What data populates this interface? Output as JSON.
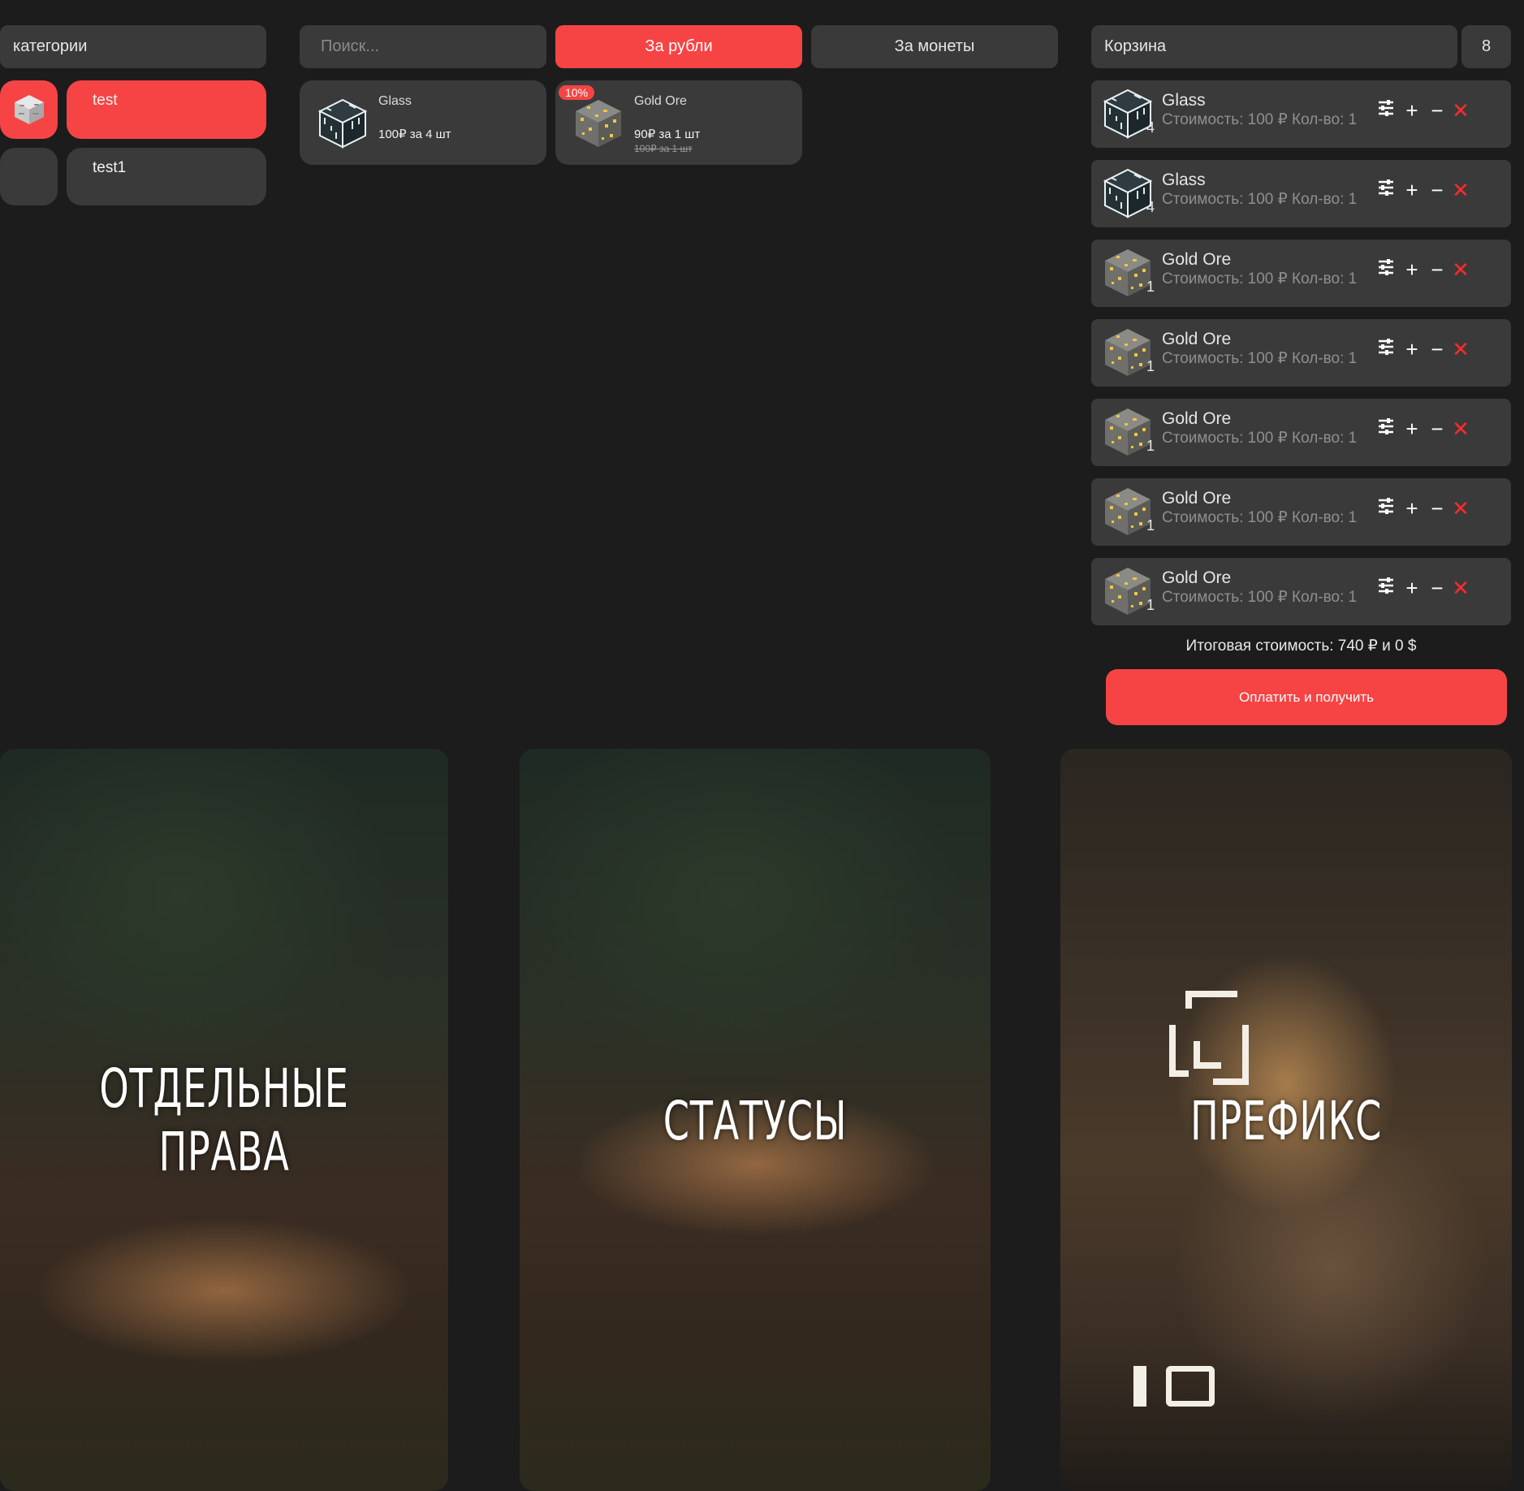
{
  "categories": {
    "header": "категории",
    "items": [
      {
        "label": "test",
        "active": true
      },
      {
        "label": "test1",
        "active": false
      }
    ]
  },
  "search": {
    "placeholder": "Поиск..."
  },
  "currency_tabs": {
    "rubles": "За рубли",
    "coins": "За монеты"
  },
  "products": [
    {
      "name": "Glass",
      "price": "100₽ за 4 шт",
      "icon": "glass-block-icon"
    },
    {
      "name": "Gold Ore",
      "price": "90₽ за 1 шт",
      "old_price": "100₽ за 1 шт",
      "discount": "10%",
      "icon": "gold-ore-icon"
    }
  ],
  "cart": {
    "title": "Корзина",
    "count": "8",
    "items": [
      {
        "name": "Glass",
        "info": "Стоимость: 100 ₽ Кол-во: 1",
        "qty": "4",
        "icon": "glass-block-icon"
      },
      {
        "name": "Glass",
        "info": "Стоимость: 100 ₽ Кол-во: 1",
        "qty": "4",
        "icon": "glass-block-icon"
      },
      {
        "name": "Gold Ore",
        "info": "Стоимость: 100 ₽ Кол-во: 1",
        "qty": "1",
        "icon": "gold-ore-icon"
      },
      {
        "name": "Gold Ore",
        "info": "Стоимость: 100 ₽ Кол-во: 1",
        "qty": "1",
        "icon": "gold-ore-icon"
      },
      {
        "name": "Gold Ore",
        "info": "Стоимость: 100 ₽ Кол-во: 1",
        "qty": "1",
        "icon": "gold-ore-icon"
      },
      {
        "name": "Gold Ore",
        "info": "Стоимость: 100 ₽ Кол-во: 1",
        "qty": "1",
        "icon": "gold-ore-icon"
      },
      {
        "name": "Gold Ore",
        "info": "Стоимость: 100 ₽ Кол-во: 1",
        "qty": "1",
        "icon": "gold-ore-icon"
      }
    ],
    "controls": {
      "plus": "+",
      "minus": "−",
      "delete": "✕"
    },
    "total": "Итоговая стоимость: 740 ₽ и 0 $",
    "pay_label": "Оплатить и получить"
  },
  "banners": [
    {
      "title_line1": "ОТДЕЛЬНЫЕ",
      "title_line2": "ПРАВА"
    },
    {
      "title_line1": "СТАТУСЫ"
    },
    {
      "title_line1": "ПРЕФИКС"
    }
  ],
  "colors": {
    "accent": "#f64444",
    "panel": "#3a3a3b",
    "background": "#1c1c1d",
    "delete": "#ff2a2a"
  }
}
